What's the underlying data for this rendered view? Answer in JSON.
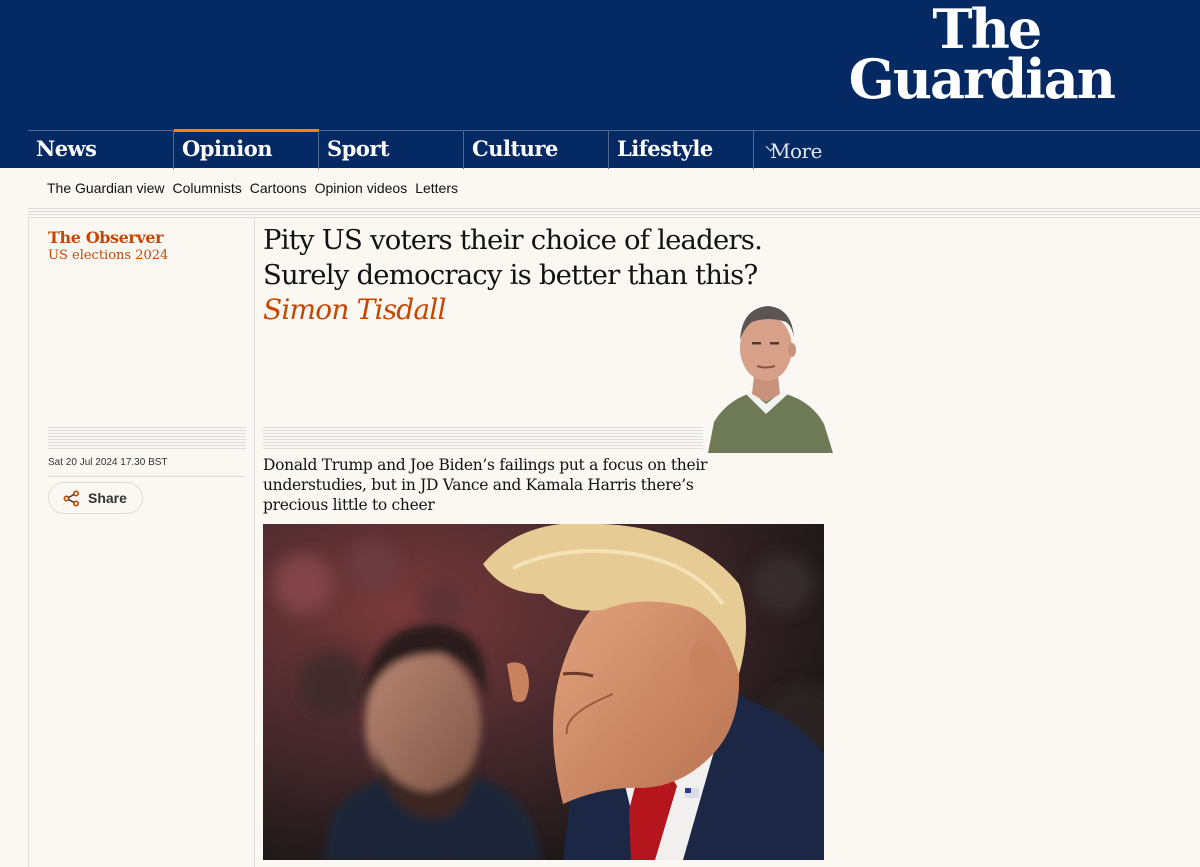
{
  "brand": {
    "line1": "The",
    "line2": "Guardian"
  },
  "pillars": [
    {
      "label": "News"
    },
    {
      "label": "Opinion"
    },
    {
      "label": "Sport"
    },
    {
      "label": "Culture"
    },
    {
      "label": "Lifestyle"
    },
    {
      "label": "More"
    }
  ],
  "subnav": [
    "The Guardian view",
    "Columnists",
    "Cartoons",
    "Opinion videos",
    "Letters"
  ],
  "article": {
    "series": "The Observer",
    "tag": "US elections 2024",
    "headline": "Pity US voters their choice of leaders. Surely democracy is better than this?",
    "author": "Simon Tisdall",
    "date": "Sat 20 Jul 2024 17.30 BST",
    "share_label": "Share",
    "standfirst": "Donald Trump and Joe Biden’s failings put a focus on their understudies, but in JD Vance and Kamala Harris there’s precious little to cheer"
  },
  "colors": {
    "brand_blue": "#052962",
    "opinion_accent": "#c74600",
    "active_pillar": "#ff7f0f",
    "page_bg": "#fbf8f4"
  },
  "icons": {
    "share": "share-icon",
    "more_chevron": "chevron-down-icon"
  }
}
